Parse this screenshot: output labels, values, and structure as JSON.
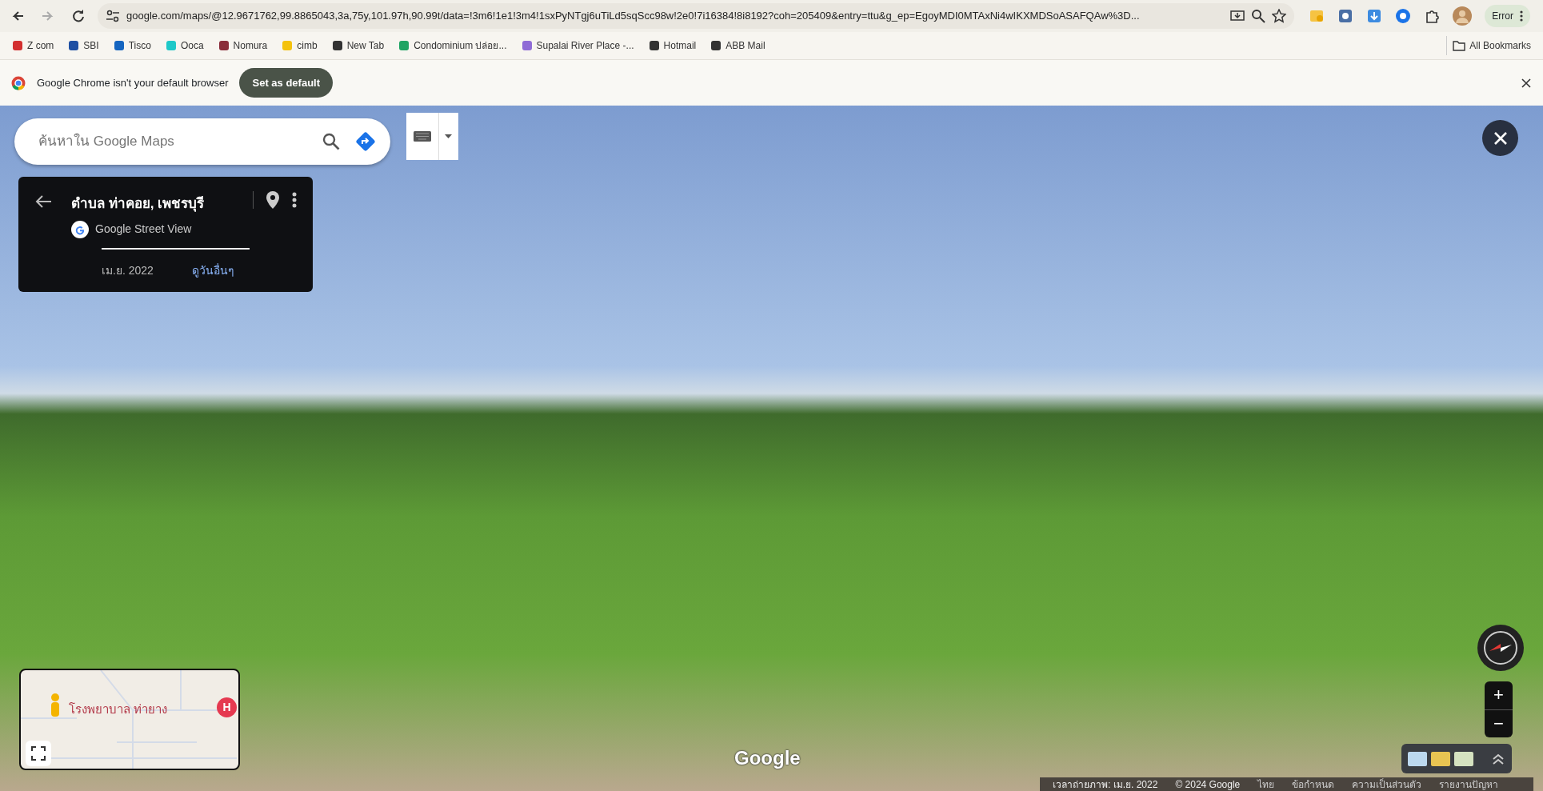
{
  "browser": {
    "url": "google.com/maps/@12.9671762,99.8865043,3a,75y,101.97h,90.99t/data=!3m6!1e1!3m4!1sxPyNTgj6uTiLd5sqScc98w!2e0!7i16384!8i8192?coh=205409&entry=ttu&g_ep=EgoyMDI0MTAxNi4wIKXMDSoASAFQAw%3D...",
    "profile_label": "Error",
    "bookmarks": [
      {
        "label": "Z com",
        "color": "#d32f2f"
      },
      {
        "label": "SBI",
        "color": "#1e4fa3"
      },
      {
        "label": "Tisco",
        "color": "#1565c0"
      },
      {
        "label": "Ooca",
        "color": "#1ec8c8"
      },
      {
        "label": "Nomura",
        "color": "#8a2d3a"
      },
      {
        "label": "cimb",
        "color": "#f4c20d"
      },
      {
        "label": "New Tab",
        "color": "#333333"
      },
      {
        "label": "Condominium ปล่อย...",
        "color": "#1fa463"
      },
      {
        "label": "Supalai River Place -...",
        "color": "#8f6bd6"
      },
      {
        "label": "Hotmail",
        "color": "#333333"
      },
      {
        "label": "ABB Mail",
        "color": "#333333"
      }
    ],
    "all_bookmarks": "All Bookmarks"
  },
  "infobar": {
    "message": "Google Chrome isn't your default browser",
    "button": "Set as default"
  },
  "maps": {
    "search": {
      "placeholder": "ค้นหาใน Google Maps"
    },
    "place_card": {
      "title": "ตำบล ท่าคอย, เพชรบุรี",
      "source": "Google Street View",
      "date": "เม.ย. 2022",
      "link": "ดูวันอื่นๆ"
    },
    "minimap": {
      "label": "โรงพยาบาล ท่ายาง",
      "marker": "H"
    },
    "logo": "Google",
    "footer": [
      "เวลาถ่ายภาพ: เม.ย. 2022",
      "© 2024 Google",
      "ไทย",
      "ข้อกำหนด",
      "ความเป็นส่วนตัว",
      "รายงานปัญหา"
    ],
    "zoom": [
      "+",
      "−"
    ]
  }
}
